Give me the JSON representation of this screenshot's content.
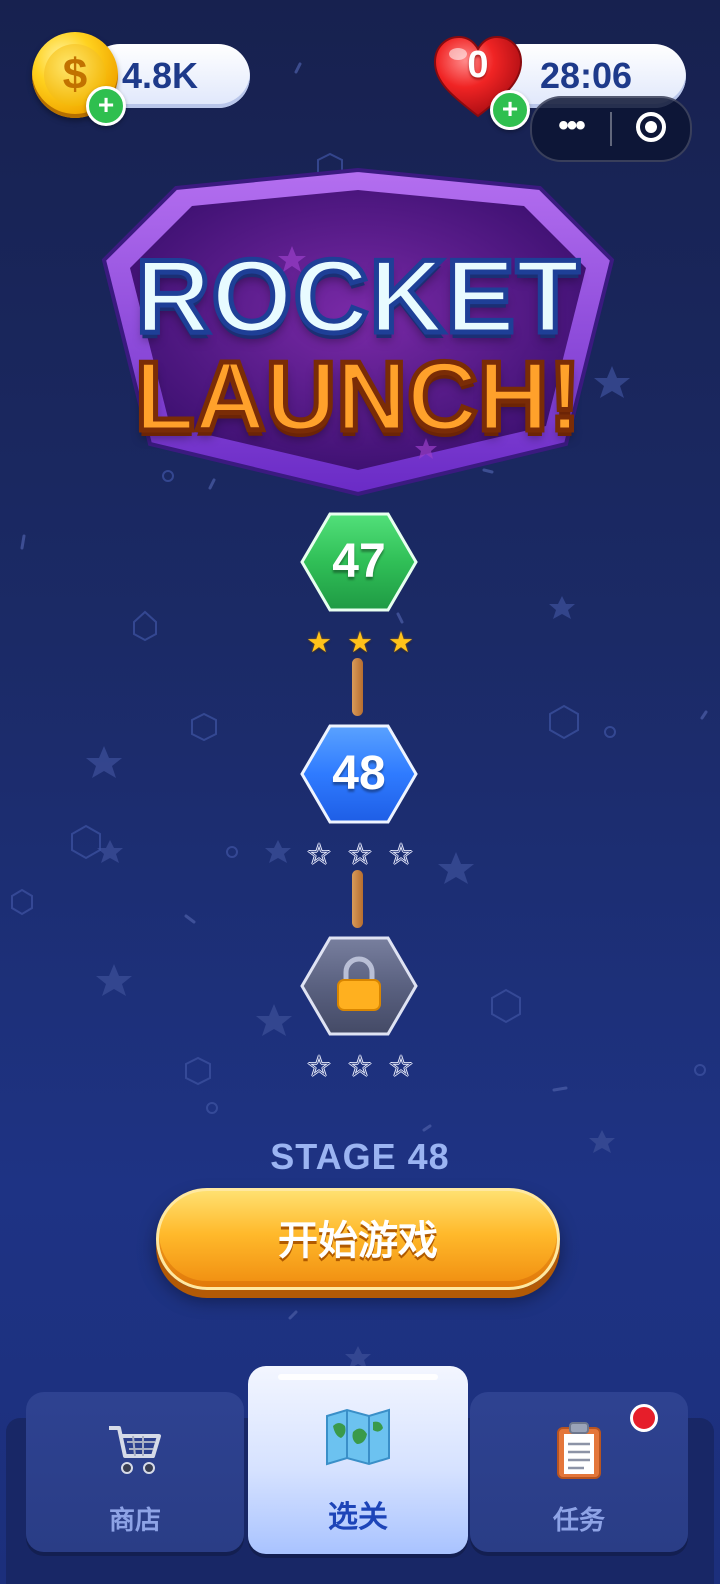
{
  "header": {
    "coins": "4.8K",
    "coin_symbol": "$",
    "lives": "0",
    "life_timer": "28:06",
    "plus": "+",
    "capsule_menu": "•••"
  },
  "logo": {
    "line1": "ROCKET",
    "line2": "LAUNCH!"
  },
  "levels": [
    {
      "number": "47",
      "state": "completed",
      "color": "#34c759",
      "stars_earned": 3,
      "stars": [
        "★",
        "★",
        "★"
      ]
    },
    {
      "number": "48",
      "state": "current",
      "color": "#2f7bff",
      "stars_earned": 0,
      "stars": [
        "☆",
        "☆",
        "☆"
      ]
    },
    {
      "number": "",
      "state": "locked",
      "color": "#5a6180",
      "stars_earned": 0,
      "stars": [
        "☆",
        "☆",
        "☆"
      ]
    }
  ],
  "stage_label": "STAGE 48",
  "start_button": "开始游戏",
  "nav": {
    "tabs": [
      {
        "label": "商店",
        "icon": "shopping-cart-icon",
        "active": false
      },
      {
        "label": "选关",
        "icon": "map-icon",
        "active": true
      },
      {
        "label": "任务",
        "icon": "clipboard-icon",
        "active": false,
        "has_notification": true
      }
    ]
  },
  "colors": {
    "background": "#1b2a66",
    "accent_gold": "#ffb92b",
    "notification": "#e61e2a"
  }
}
